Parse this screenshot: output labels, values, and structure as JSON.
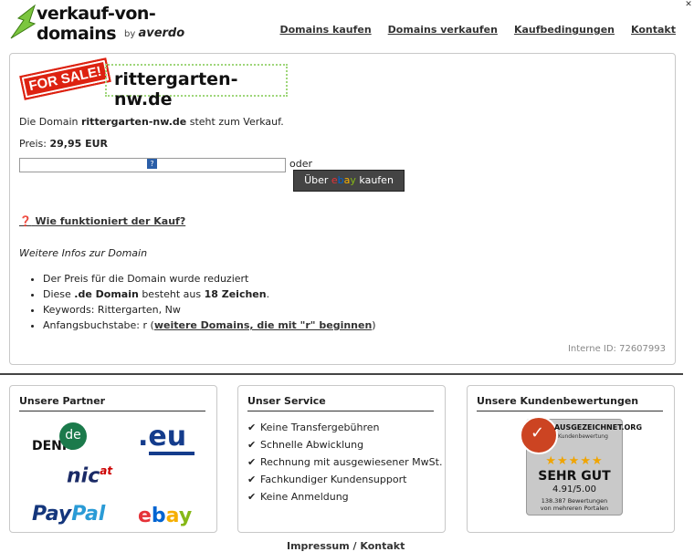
{
  "header": {
    "logo_text": "verkauf-von-domains",
    "logo_by": "by",
    "logo_brand": "averdo",
    "nav": [
      "Domains kaufen",
      "Domains verkaufen",
      "Kaufbedingungen",
      "Kontakt"
    ]
  },
  "main": {
    "for_sale": "FOR SALE!",
    "domain": "rittergarten-nw.de",
    "description_pre": "Die Domain ",
    "description_domain": "rittergarten-nw.de",
    "description_post": " steht zum Verkauf.",
    "price_label": "Preis:",
    "price_value": "29,95 EUR",
    "or_label": "oder",
    "ebay_pre": "Über",
    "ebay_post": "kaufen",
    "how_label": "Wie funktioniert der Kauf?",
    "more_info": "Weitere Infos zur Domain",
    "info": {
      "reduced": "Der Preis für die Domain wurde reduziert",
      "length_pre": "Diese ",
      "length_tld": ".de Domain",
      "length_mid": " besteht aus ",
      "length_count": "18 Zeichen",
      "length_post": ".",
      "keywords": "Keywords: Rittergarten, Nw",
      "initial_pre": "Anfangsbuchstabe: r (",
      "initial_link": "weitere Domains, die mit \"r\" beginnen",
      "initial_post": ")"
    },
    "internal_id": "Interne ID: 72607993"
  },
  "panels": {
    "partners_title": "Unsere Partner",
    "service_title": "Unser Service",
    "service_items": [
      "Keine Transfergebühren",
      "Schnelle Abwicklung",
      "Rechnung mit ausgewiesener MwSt.",
      "Fachkundiger Kundensupport",
      "Keine Anmeldung"
    ],
    "reviews_title": "Unsere Kundenbewertungen",
    "rating": {
      "brand": "AUSGEZEICHNET.ORG",
      "brand_sub": "Kundenbewertung",
      "grade": "SEHR GUT",
      "score": "4.91/5.00",
      "count_line1": "138.387 Bewertungen",
      "count_line2": "von mehreren Portalen"
    }
  },
  "footer": {
    "text": "Impressum / Kontakt"
  }
}
